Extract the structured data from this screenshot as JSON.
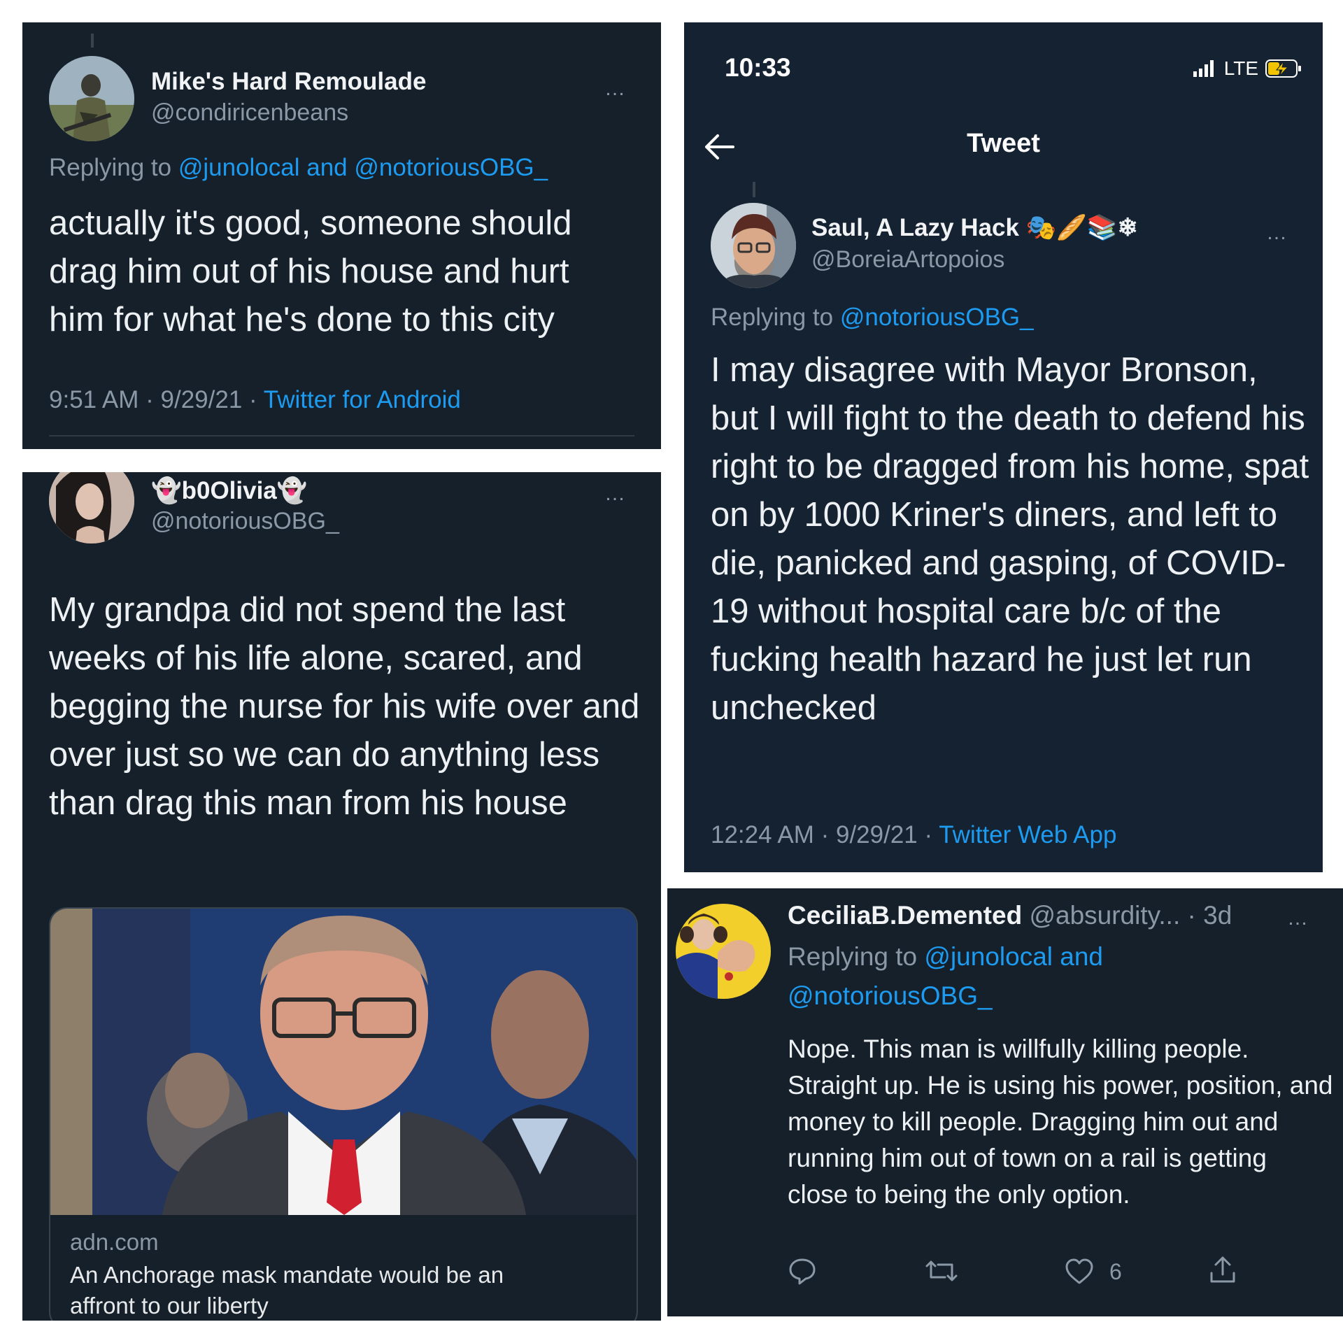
{
  "tweet1": {
    "name": "Mike's Hard Remoulade",
    "handle": "@condiricenbeans",
    "replying_prefix": "Replying to ",
    "replying_to": "@junolocal and @notoriousOBG_",
    "text": "actually it's good, someone should drag him out of his house and hurt him for what he's done to this city",
    "time": "9:51 AM · 9/29/21 · ",
    "source": "Twitter for Android"
  },
  "tweet2": {
    "name": "b0Olivia",
    "name_emoji": "👻",
    "handle": "@notoriousOBG_",
    "text": "My grandpa did not spend the last weeks of his life alone, scared, and begging the nurse for his wife over and over just so we can do anything less than drag this man from his house",
    "card": {
      "domain": "adn.com",
      "title": "An Anchorage mask mandate would be an affront to our liberty"
    }
  },
  "tweet3": {
    "status_time": "10:33",
    "network": "LTE",
    "header_title": "Tweet",
    "name": "Saul, A Lazy Hack",
    "name_emojis": "🎭🥖📚❄",
    "handle": "@BoreiaArtopoios",
    "replying_prefix": "Replying to ",
    "replying_to": "@notoriousOBG_",
    "text": "I may disagree with Mayor Bronson, but I will fight to the death to defend his right to be dragged from his home, spat on by 1000 Kriner's diners, and left to die, panicked and gasping, of COVID-19 without hospital care b/c of the fucking health hazard he just let run unchecked",
    "time": "12:24 AM · 9/29/21 · ",
    "source": "Twitter Web App"
  },
  "tweet4": {
    "name": "CeciliaB.Demented",
    "handle": "@absurdity...",
    "age": " · 3d",
    "replying_prefix": "Replying to ",
    "replying_line1": "@junolocal and",
    "replying_line2": "@notoriousOBG_",
    "text": "Nope. This man is willfully killing people. Straight up. He is using his power, position, and money to kill people. Dragging him out and running him out of town on a rail is getting close to being the only option.",
    "likes": "6"
  },
  "more_icon": "…",
  "colors": {
    "background": "#15202b",
    "link": "#1d9bf0",
    "muted": "#8b98a5",
    "text": "#e7e9ea",
    "tie": "#d1202f"
  }
}
